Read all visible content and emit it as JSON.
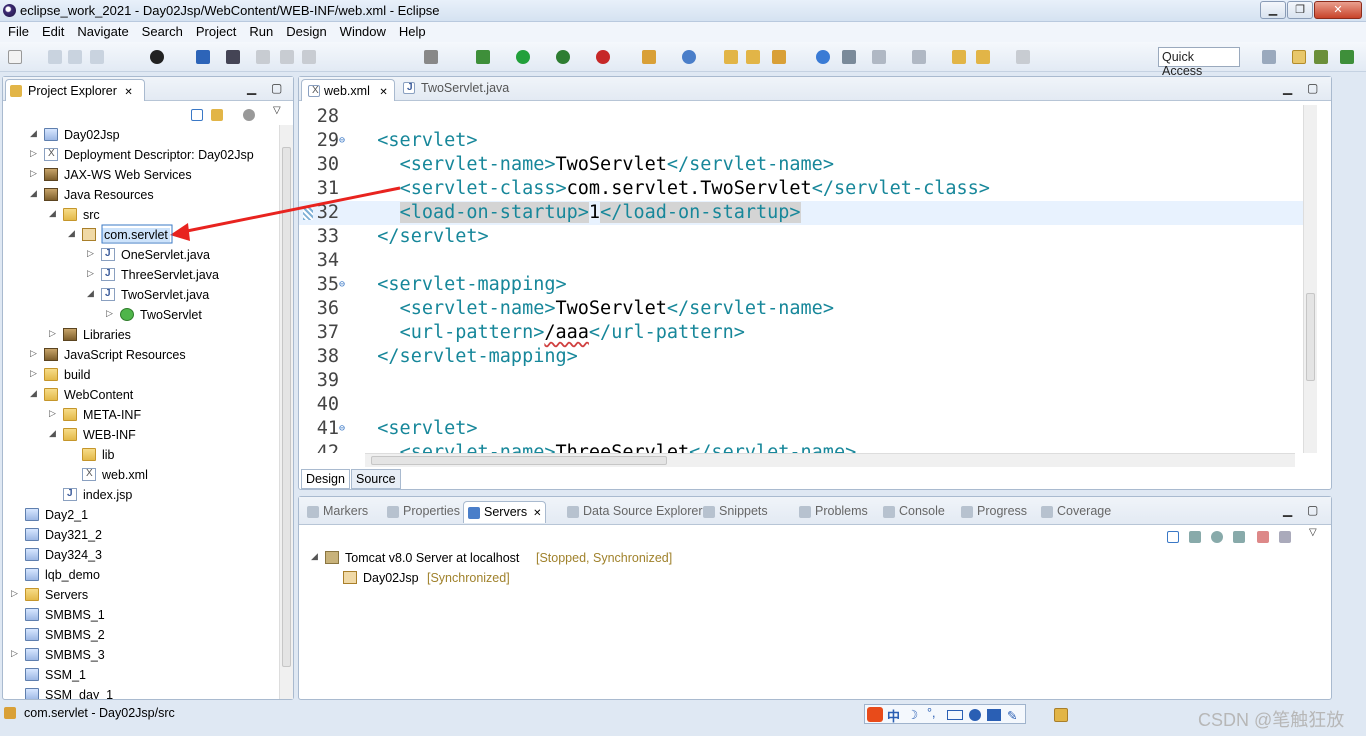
{
  "window": {
    "title": "eclipse_work_2021 - Day02Jsp/WebContent/WEB-INF/web.xml - Eclipse",
    "min_symbol": "▁",
    "max_symbol": "❐",
    "close_symbol": "✕"
  },
  "menu": [
    "File",
    "Edit",
    "Navigate",
    "Search",
    "Project",
    "Run",
    "Design",
    "Window",
    "Help"
  ],
  "toolbar": {
    "quick_access": "Quick Access"
  },
  "project_explorer": {
    "tab_label": "Project Explorer",
    "tab_close": "✕",
    "tree": [
      {
        "label": "Day02Jsp",
        "toggle": "◢",
        "icon": "proj"
      },
      {
        "label": "Deployment Descriptor: Day02Jsp",
        "toggle": "▷",
        "icon": "xml"
      },
      {
        "label": "JAX-WS Web Services",
        "toggle": "▷",
        "icon": "lib"
      },
      {
        "label": "Java Resources",
        "toggle": "◢",
        "icon": "lib"
      },
      {
        "label": "src",
        "toggle": "◢",
        "icon": "folder"
      },
      {
        "label": "com.servlet",
        "toggle": "◢",
        "icon": "pkg",
        "selected": true
      },
      {
        "label": "OneServlet.java",
        "toggle": "▷",
        "icon": "java"
      },
      {
        "label": "ThreeServlet.java",
        "toggle": "▷",
        "icon": "java"
      },
      {
        "label": "TwoServlet.java",
        "toggle": "◢",
        "icon": "java"
      },
      {
        "label": "TwoServlet",
        "toggle": "▷",
        "icon": "cls"
      },
      {
        "label": "Libraries",
        "toggle": "▷",
        "icon": "lib"
      },
      {
        "label": "JavaScript Resources",
        "toggle": "▷",
        "icon": "lib"
      },
      {
        "label": "build",
        "toggle": "▷",
        "icon": "folder"
      },
      {
        "label": "WebContent",
        "toggle": "◢",
        "icon": "folder"
      },
      {
        "label": "META-INF",
        "toggle": "▷",
        "icon": "folder"
      },
      {
        "label": "WEB-INF",
        "toggle": "◢",
        "icon": "folder"
      },
      {
        "label": "lib",
        "toggle": "",
        "icon": "folder"
      },
      {
        "label": "web.xml",
        "toggle": "",
        "icon": "xml"
      },
      {
        "label": "index.jsp",
        "toggle": "",
        "icon": "java"
      },
      {
        "label": "Day2_1",
        "toggle": "",
        "icon": "proj"
      },
      {
        "label": "Day321_2",
        "toggle": "",
        "icon": "proj"
      },
      {
        "label": "Day324_3",
        "toggle": "",
        "icon": "proj"
      },
      {
        "label": "lqb_demo",
        "toggle": "",
        "icon": "proj"
      },
      {
        "label": "Servers",
        "toggle": "▷",
        "icon": "folder"
      },
      {
        "label": "SMBMS_1",
        "toggle": "",
        "icon": "proj"
      },
      {
        "label": "SMBMS_2",
        "toggle": "",
        "icon": "proj"
      },
      {
        "label": "SMBMS_3",
        "toggle": "▷",
        "icon": "proj"
      },
      {
        "label": "SSM_1",
        "toggle": "",
        "icon": "proj"
      },
      {
        "label": "SSM_day_1",
        "toggle": "",
        "icon": "proj"
      }
    ]
  },
  "editor": {
    "tabs": [
      {
        "label": "web.xml",
        "active": true,
        "close": "✕"
      },
      {
        "label": "TwoServlet.java",
        "active": false
      }
    ],
    "lines": [
      {
        "num": "28",
        "fold": "",
        "indent": "",
        "parts": []
      },
      {
        "num": "29",
        "fold": "⊖",
        "indent": "  ",
        "parts": [
          {
            "t": "<servlet>",
            "c": "tag"
          }
        ]
      },
      {
        "num": "30",
        "fold": "",
        "indent": "    ",
        "parts": [
          {
            "t": "<servlet-name>",
            "c": "tag"
          },
          {
            "t": "TwoServlet",
            "c": "txt"
          },
          {
            "t": "</servlet-name>",
            "c": "tag"
          }
        ]
      },
      {
        "num": "31",
        "fold": "",
        "indent": "    ",
        "parts": [
          {
            "t": "<servlet-class>",
            "c": "tag"
          },
          {
            "t": "com.servlet.TwoServlet",
            "c": "txt"
          },
          {
            "t": "</servlet-class>",
            "c": "tag"
          }
        ]
      },
      {
        "num": "32",
        "fold": "",
        "indent": "    ",
        "current": true,
        "parts": [
          {
            "t": "<load-on-startup>",
            "c": "tag hl"
          },
          {
            "t": "1",
            "c": "txt"
          },
          {
            "t": "</load-on-startup>",
            "c": "tag hl"
          }
        ]
      },
      {
        "num": "33",
        "fold": "",
        "indent": "  ",
        "parts": [
          {
            "t": "</servlet>",
            "c": "tag"
          }
        ]
      },
      {
        "num": "34",
        "fold": "",
        "indent": "",
        "parts": []
      },
      {
        "num": "35",
        "fold": "⊖",
        "indent": "  ",
        "parts": [
          {
            "t": "<servlet-mapping>",
            "c": "tag"
          }
        ]
      },
      {
        "num": "36",
        "fold": "",
        "indent": "    ",
        "parts": [
          {
            "t": "<servlet-name>",
            "c": "tag"
          },
          {
            "t": "TwoServlet",
            "c": "txt"
          },
          {
            "t": "</servlet-name>",
            "c": "tag"
          }
        ]
      },
      {
        "num": "37",
        "fold": "",
        "indent": "    ",
        "parts": [
          {
            "t": "<url-pattern>",
            "c": "tag"
          },
          {
            "t": "/aaa",
            "c": "txt"
          },
          {
            "t": "</url-pattern>",
            "c": "tag"
          }
        ]
      },
      {
        "num": "38",
        "fold": "",
        "indent": "  ",
        "parts": [
          {
            "t": "</servlet-mapping>",
            "c": "tag"
          }
        ]
      },
      {
        "num": "39",
        "fold": "",
        "indent": "",
        "parts": []
      },
      {
        "num": "40",
        "fold": "",
        "indent": "",
        "parts": []
      },
      {
        "num": "41",
        "fold": "⊖",
        "indent": "  ",
        "parts": [
          {
            "t": "<servlet>",
            "c": "tag"
          }
        ]
      },
      {
        "num": "42",
        "fold": "",
        "indent": "    ",
        "parts": [
          {
            "t": "<servlet-name>",
            "c": "tag"
          },
          {
            "t": "ThreeServlet",
            "c": "txt"
          },
          {
            "t": "</servlet-name>",
            "c": "tag"
          }
        ]
      }
    ],
    "bottom_tabs": {
      "design": "Design",
      "source": "Source"
    }
  },
  "bottom_panel": {
    "tabs": [
      {
        "label": "Markers",
        "active": false
      },
      {
        "label": "Properties",
        "active": false
      },
      {
        "label": "Servers",
        "active": true,
        "close": "✕"
      },
      {
        "label": "Data Source Explorer",
        "active": false
      },
      {
        "label": "Snippets",
        "active": false
      },
      {
        "label": "Problems",
        "active": false
      },
      {
        "label": "Console",
        "active": false
      },
      {
        "label": "Progress",
        "active": false
      },
      {
        "label": "Coverage",
        "active": false
      }
    ],
    "server": {
      "name": "Tomcat v8.0 Server at localhost",
      "state": "[Stopped, Synchronized]",
      "toggle": "◢"
    },
    "module": {
      "name": "Day02Jsp",
      "state": "[Synchronized]"
    }
  },
  "status_bar": {
    "text": "com.servlet - Day02Jsp/src"
  },
  "ime": {
    "label": "中"
  },
  "watermark": "CSDN @笔触狂放",
  "colors": {
    "tag": "#17879a",
    "accent": "#3a78c6",
    "annotation_arrow": "#e8231f"
  }
}
